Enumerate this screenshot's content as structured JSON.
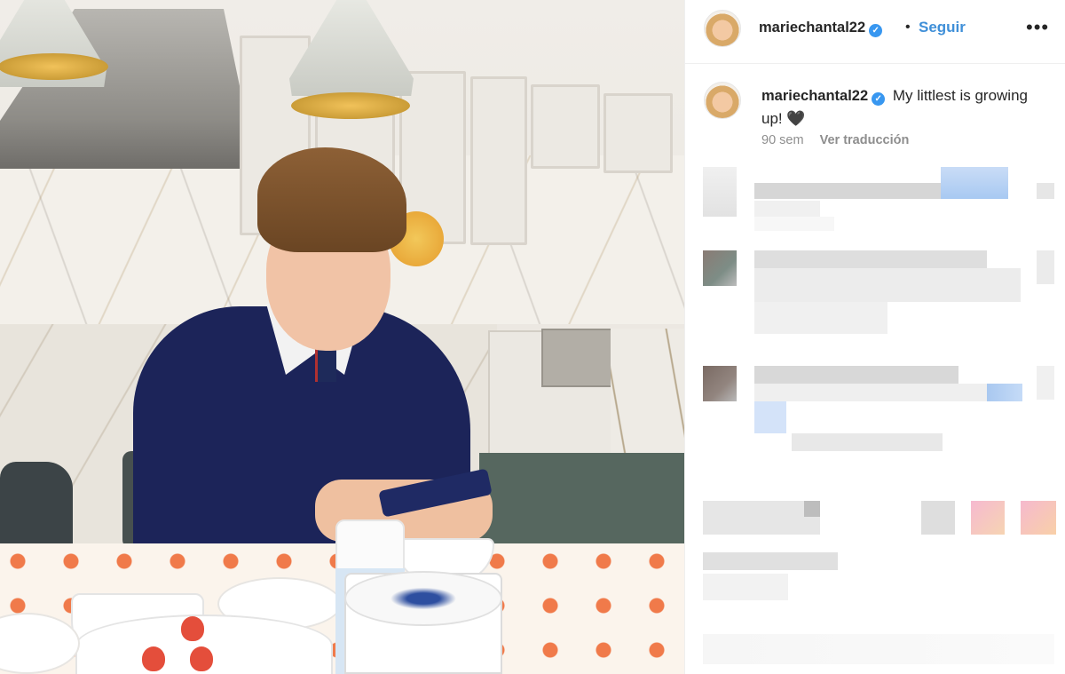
{
  "post": {
    "username": "mariechantal22",
    "verified_icon": "verified-badge-icon",
    "separator": "•",
    "follow_label": "Seguir",
    "more_icon": "more-options-icon",
    "more_glyph": "•••"
  },
  "caption": {
    "username": "mariechantal22",
    "text": "My littlest is growing up! 🖤",
    "time": "90 sem",
    "translate_label": "Ver traducción"
  },
  "colors": {
    "link": "#3f8fd8",
    "verified": "#3897f0",
    "muted": "#8e8e8e"
  }
}
